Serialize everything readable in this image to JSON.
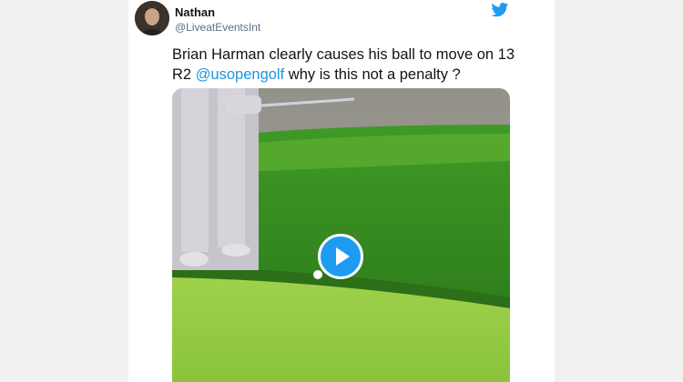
{
  "author": {
    "display_name": "Nathan",
    "handle": "@LiveatEventsInt"
  },
  "tweet": {
    "text_before": "Brian Harman clearly causes his ball to move on 13 R2 ",
    "mention": "@usopengolf",
    "text_after": " why is this not a penalty ?"
  },
  "icons": {
    "brand": "twitter-bird-icon",
    "play": "play-icon"
  },
  "colors": {
    "link": "#1b95e0",
    "twitter_blue": "#1d9bf0"
  }
}
